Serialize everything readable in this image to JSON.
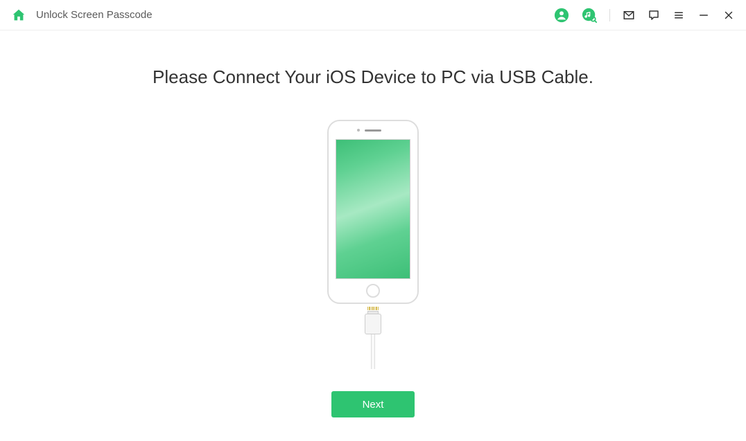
{
  "header": {
    "title": "Unlock Screen Passcode",
    "icons": {
      "home": "home-icon",
      "user": "user-icon",
      "music": "music-icon",
      "mail": "mail-icon",
      "feedback": "feedback-icon",
      "menu": "menu-icon",
      "minimize": "minimize-icon",
      "close": "close-icon"
    }
  },
  "main": {
    "heading": "Please Connect Your iOS Device to PC via USB Cable.",
    "next_label": "Next"
  },
  "colors": {
    "accent": "#2ec471"
  }
}
